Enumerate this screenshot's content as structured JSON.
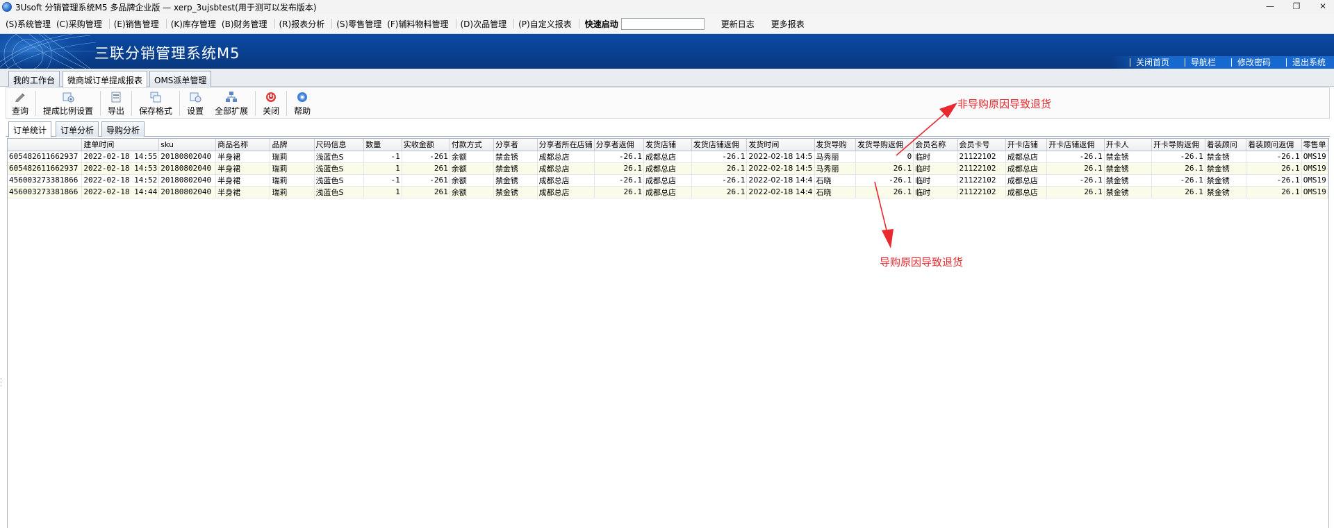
{
  "window": {
    "title": "3Usoft 分销管理系统M5 多品牌企业版 — xerp_3ujsbtest(用于测可以发布版本)",
    "controls": {
      "minimize": "—",
      "restore": "❐",
      "close": "✕"
    }
  },
  "menu": {
    "items": [
      "(S)系统管理",
      "(C)采购管理",
      "(E)销售管理",
      "(K)库存管理",
      "(B)财务管理",
      "(R)报表分析",
      "(S)零售管理",
      "(F)辅料物料管理",
      "(D)次品管理",
      "(P)自定义报表"
    ],
    "quick_launch_label": "快速启动",
    "quick_launch_value": "",
    "update_log": "更新日志",
    "more_reports": "更多报表"
  },
  "banner": {
    "title": "三联分销管理系统M5",
    "nav": [
      "关闭首页",
      "导航栏",
      "修改密码",
      "退出系统"
    ]
  },
  "main_tabs": [
    "我的工作台",
    "微商城订单提成报表",
    "OMS派单管理"
  ],
  "main_tab_active": 1,
  "toolbar": {
    "query": "查询",
    "ratio_settings": "提成比例设置",
    "export": "导出",
    "save_format": "保存格式",
    "settings": "设置",
    "expand_all": "全部扩展",
    "close": "关闭",
    "help": "帮助"
  },
  "sub_tabs": [
    "订单统计",
    "订单分析",
    "导购分析"
  ],
  "sub_tab_active": 0,
  "grid": {
    "columns": [
      "",
      "建单时间",
      "sku",
      "商品名称",
      "品牌",
      "尺码信息",
      "数量",
      "实收金额",
      "付款方式",
      "分享者",
      "分享者所在店铺",
      "分享者返佣",
      "发货店铺",
      "发货店铺返佣",
      "发货时间",
      "发货导购",
      "发货导购返佣",
      "会员名称",
      "会员卡号",
      "开卡店铺",
      "开卡店铺返佣",
      "开卡人",
      "开卡导购返佣",
      "着装顾问",
      "着装顾问返佣",
      "零售单"
    ],
    "rows": [
      [
        "605482611662937",
        "2022-02-18 14:55",
        "20180802040",
        "半身裙",
        "瑞莉",
        "浅蓝色S",
        "-1",
        "-261",
        "余额",
        "禁金锈",
        "成都总店",
        "-26.1",
        "成都总店",
        "-26.1",
        "2022-02-18 14:5",
        "马秀丽",
        "0",
        "临时",
        "21122102",
        "成都总店",
        "-26.1",
        "禁金锈",
        "-26.1",
        "禁金锈",
        "-26.1",
        "OMS19"
      ],
      [
        "605482611662937",
        "2022-02-18 14:53",
        "20180802040",
        "半身裙",
        "瑞莉",
        "浅蓝色S",
        "1",
        "261",
        "余额",
        "禁金锈",
        "成都总店",
        "26.1",
        "成都总店",
        "26.1",
        "2022-02-18 14:5",
        "马秀丽",
        "26.1",
        "临时",
        "21122102",
        "成都总店",
        "26.1",
        "禁金锈",
        "26.1",
        "禁金锈",
        "26.1",
        "OMS19"
      ],
      [
        "456003273381866",
        "2022-02-18 14:52",
        "20180802040",
        "半身裙",
        "瑞莉",
        "浅蓝色S",
        "-1",
        "-261",
        "余额",
        "禁金锈",
        "成都总店",
        "-26.1",
        "成都总店",
        "-26.1",
        "2022-02-18 14:4",
        "石晓",
        "-26.1",
        "临时",
        "21122102",
        "成都总店",
        "-26.1",
        "禁金锈",
        "-26.1",
        "禁金锈",
        "-26.1",
        "OMS19"
      ],
      [
        "456003273381866",
        "2022-02-18 14:44",
        "20180802040",
        "半身裙",
        "瑞莉",
        "浅蓝色S",
        "1",
        "261",
        "余额",
        "禁金锈",
        "成都总店",
        "26.1",
        "成都总店",
        "26.1",
        "2022-02-18 14:4",
        "石晓",
        "26.1",
        "临时",
        "21122102",
        "成都总店",
        "26.1",
        "禁金锈",
        "26.1",
        "禁金锈",
        "26.1",
        "OMS19"
      ]
    ]
  },
  "annotations": {
    "top": "非导购原因导致退货",
    "bottom": "导购原因导致退货",
    "color": "#e8292f"
  },
  "colors": {
    "banner": "#0b4aa3",
    "row_alt": "#fbfbea",
    "annotation": "#e8292f"
  }
}
